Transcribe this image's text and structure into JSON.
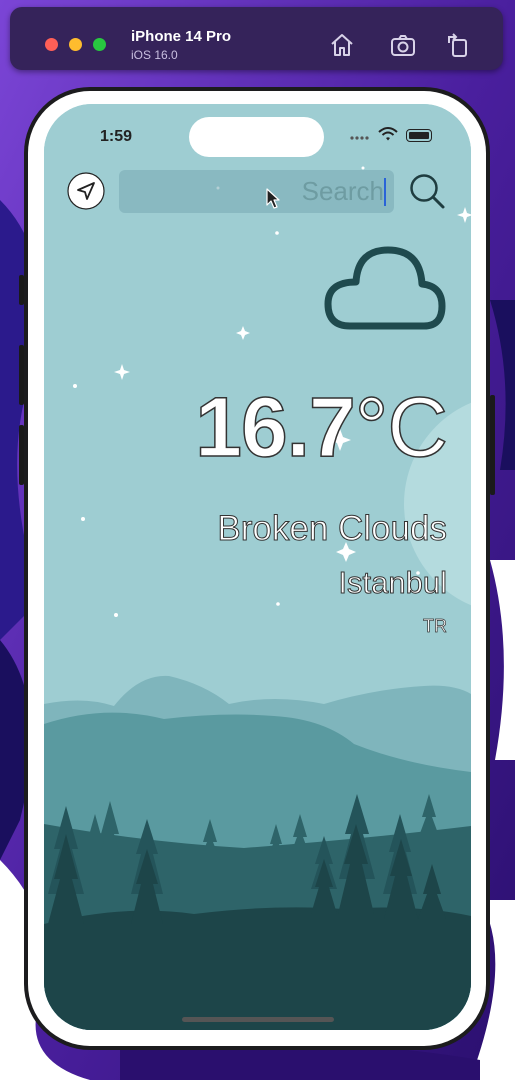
{
  "simulator": {
    "device_name": "iPhone 14 Pro",
    "os_version": "iOS 16.0",
    "toolbar_icons": [
      "home-icon",
      "screenshot-icon",
      "rotate-icon"
    ]
  },
  "status_bar": {
    "time": "1:59"
  },
  "search": {
    "placeholder": "Search"
  },
  "weather": {
    "condition_icon": "cloud-icon",
    "temperature": "16.7",
    "unit": "°C",
    "description": "Broken Clouds",
    "city": "Istanbul",
    "country": "TR"
  },
  "colors": {
    "sky": "#9ecdd2",
    "hills_light": "#7fb5bc",
    "hills_mid": "#5a9aa0",
    "trees_dark": "#2e6469",
    "ground": "#1d4549",
    "cloud_stroke": "#1f4a4e"
  }
}
